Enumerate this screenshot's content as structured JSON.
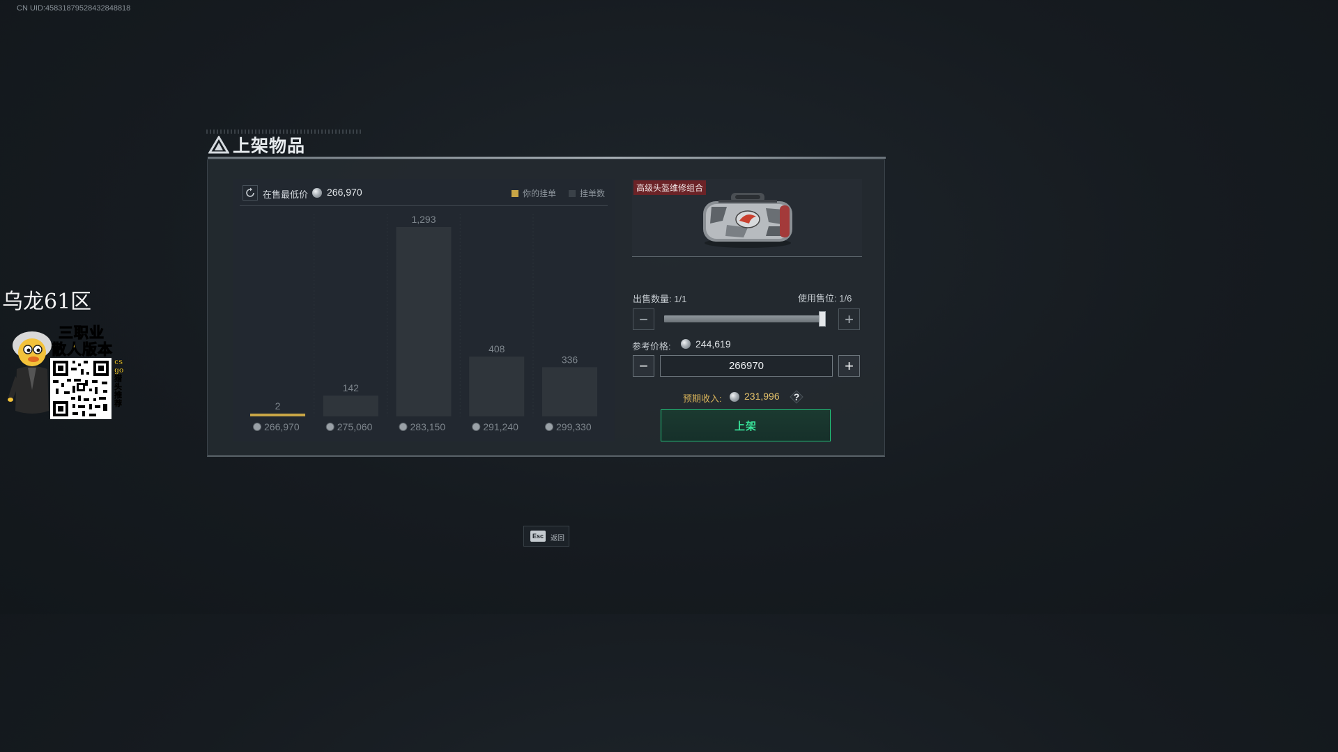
{
  "uid_text": "CN UID:4583187952843284881​8",
  "overlay": {
    "title": "乌龙61区",
    "promo_line1": "三职业",
    "promo_line2": "散人版本",
    "side_text": "csgo猎头推荐"
  },
  "dialog": {
    "title": "上架物品",
    "chart_header": {
      "lowest_label": "在售最低价",
      "lowest_value": "266,970",
      "legend_yours": "你的挂单",
      "legend_count": "挂单数"
    },
    "item": {
      "name": "高级头盔维修组合"
    },
    "sell_quantity_label": "出售数量:",
    "sell_quantity_value": "1/1",
    "slots_label": "使用售位:",
    "slots_value": "1/6",
    "qty_minus": "−",
    "qty_plus": "+",
    "ref_price_label": "参考价格:",
    "ref_price_value": "244,619",
    "price_minus": "−",
    "price_plus": "+",
    "price_input_value": "266970",
    "expected_label": "预期收入:",
    "expected_value": "231,996",
    "help": "?",
    "list_button": "上架",
    "quantity_fraction": 1.0
  },
  "esc_hint": {
    "key": "Esc",
    "label": "返回"
  },
  "colors": {
    "accent_green": "#20c47a",
    "your_listing": "#c9a646",
    "count_bar": "#2f353b",
    "expected_gold": "#d8b35a"
  },
  "chart_data": {
    "type": "bar",
    "categories": [
      "266,970",
      "275,060",
      "283,150",
      "291,240",
      "299,330"
    ],
    "values": [
      2,
      142,
      1293,
      408,
      336
    ],
    "value_labels": [
      "2",
      "142",
      "1,293",
      "408",
      "336"
    ],
    "highlight_index": 0,
    "legend": [
      "你的挂单",
      "挂单数"
    ],
    "ylim": [
      0,
      1293
    ]
  }
}
